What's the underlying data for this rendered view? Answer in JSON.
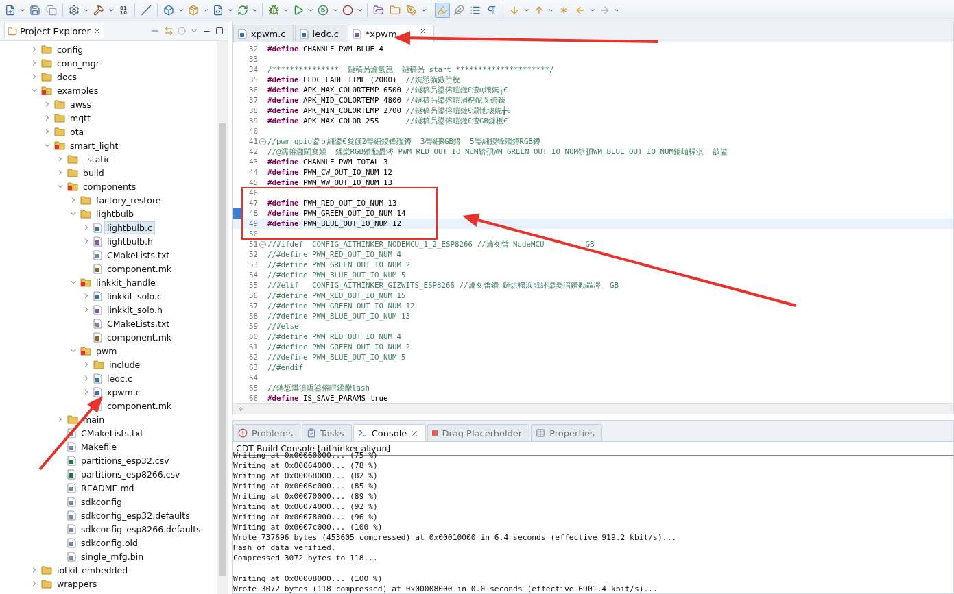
{
  "explorer": {
    "title": "Project Explorer",
    "tree": [
      {
        "label": "config",
        "kind": "folder",
        "expanded": false,
        "selected": false
      },
      {
        "label": "conn_mgr",
        "kind": "folder",
        "expanded": false,
        "selected": false
      },
      {
        "label": "docs",
        "kind": "folder",
        "expanded": false,
        "selected": false
      },
      {
        "label": "examples",
        "kind": "project",
        "expanded": true,
        "selected": false,
        "children": [
          {
            "label": "awss",
            "kind": "folder",
            "expanded": false,
            "selected": false
          },
          {
            "label": "mqtt",
            "kind": "folder",
            "expanded": false,
            "selected": false
          },
          {
            "label": "ota",
            "kind": "folder",
            "expanded": false,
            "selected": false
          },
          {
            "label": "smart_light",
            "kind": "project",
            "expanded": true,
            "selected": false,
            "children": [
              {
                "label": "_static",
                "kind": "folder",
                "expanded": false,
                "selected": false
              },
              {
                "label": "build",
                "kind": "folder",
                "expanded": false,
                "selected": false
              },
              {
                "label": "components",
                "kind": "project",
                "expanded": true,
                "selected": false,
                "children": [
                  {
                    "label": "factory_restore",
                    "kind": "folder",
                    "expanded": false,
                    "selected": false
                  },
                  {
                    "label": "lightbulb",
                    "kind": "folder",
                    "expanded": true,
                    "selected": false,
                    "children": [
                      {
                        "label": "lightbulb.c",
                        "kind": "source",
                        "expanded": false,
                        "selected": true
                      },
                      {
                        "label": "lightbulb.h",
                        "kind": "header",
                        "expanded": false,
                        "selected": false
                      },
                      {
                        "label": "CMakeLists.txt",
                        "kind": "text",
                        "selected": false
                      },
                      {
                        "label": "component.mk",
                        "kind": "make",
                        "selected": false
                      }
                    ]
                  },
                  {
                    "label": "linkkit_handle",
                    "kind": "project",
                    "expanded": true,
                    "selected": false,
                    "children": [
                      {
                        "label": "linkkit_solo.c",
                        "kind": "source",
                        "expanded": false,
                        "selected": false
                      },
                      {
                        "label": "linkkit_solo.h",
                        "kind": "header",
                        "expanded": false,
                        "selected": false
                      },
                      {
                        "label": "CMakeLists.txt",
                        "kind": "text",
                        "selected": false
                      },
                      {
                        "label": "component.mk",
                        "kind": "make",
                        "selected": false
                      }
                    ]
                  },
                  {
                    "label": "pwm",
                    "kind": "project",
                    "expanded": true,
                    "selected": false,
                    "children": [
                      {
                        "label": "include",
                        "kind": "folder",
                        "expanded": false,
                        "selected": false
                      },
                      {
                        "label": "ledc.c",
                        "kind": "source",
                        "expanded": false,
                        "selected": false
                      },
                      {
                        "label": "xpwm.c",
                        "kind": "source",
                        "expanded": false,
                        "selected": false
                      },
                      {
                        "label": "component.mk",
                        "kind": "make",
                        "selected": false
                      }
                    ]
                  }
                ]
              },
              {
                "label": "main",
                "kind": "folder",
                "expanded": false,
                "selected": false
              },
              {
                "label": "CMakeLists.txt",
                "kind": "text",
                "selected": false
              },
              {
                "label": "Makefile",
                "kind": "text",
                "selected": false
              },
              {
                "label": "partitions_esp32.csv",
                "kind": "sheet",
                "selected": false
              },
              {
                "label": "partitions_esp8266.csv",
                "kind": "sheet",
                "selected": false
              },
              {
                "label": "README.md",
                "kind": "text",
                "selected": false
              },
              {
                "label": "sdkconfig",
                "kind": "text",
                "selected": false
              },
              {
                "label": "sdkconfig_esp32.defaults",
                "kind": "text",
                "selected": false
              },
              {
                "label": "sdkconfig_esp8266.defaults",
                "kind": "text",
                "selected": false
              },
              {
                "label": "sdkconfig.old",
                "kind": "text",
                "selected": false
              },
              {
                "label": "single_mfg.bin",
                "kind": "text",
                "selected": false
              }
            ]
          }
        ]
      },
      {
        "label": "iotkit-embedded",
        "kind": "folder",
        "expanded": false,
        "selected": false
      },
      {
        "label": "wrappers",
        "kind": "folder",
        "expanded": false,
        "selected": false
      }
    ]
  },
  "editor_tabs": [
    {
      "label": "xpwm.c",
      "kind": "source",
      "selected": false,
      "closable": false
    },
    {
      "label": "ledc.c",
      "kind": "source",
      "selected": false,
      "closable": false
    },
    {
      "label": "*xpwm",
      "kind": "header",
      "selected": true,
      "closable": true
    }
  ],
  "code": [
    {
      "n": "32",
      "parts": [
        {
          "kind": "keyword",
          "text": "#define"
        },
        {
          "kind": "plain",
          "text": " CHANNLE_PWM_BLUE 4"
        }
      ]
    },
    {
      "n": "33"
    },
    {
      "n": "34",
      "parts": [
        {
          "kind": "comment",
          "text": "/***************  鐩稿叧瀹氫箟  鐩稿叧 start *********************/"
        }
      ]
    },
    {
      "n": "35",
      "parts": [
        {
          "kind": "keyword",
          "text": "#define"
        },
        {
          "kind": "plain",
          "text": " LEDC_FADE_TIME (2000)  "
        },
        {
          "kind": "comment",
          "text": "//娓愬彉鏃堕棿"
        }
      ]
    },
    {
      "n": "36",
      "parts": [
        {
          "kind": "keyword",
          "text": "#define"
        },
        {
          "kind": "plain",
          "text": " APK_MAX_COLORTEMP 6500 "
        },
        {
          "kind": "comment",
          "text": "//鐩稿叧鍙傛暟鏈€澶ц壊娓╁€"
        }
      ]
    },
    {
      "n": "37",
      "parts": [
        {
          "kind": "keyword",
          "text": "#define"
        },
        {
          "kind": "plain",
          "text": " APK_MID_COLORTEMP 4800 "
        },
        {
          "kind": "comment",
          "text": "//鐩稿叧鍙傛暟涓棿鑹叉俯鍊"
        }
      ]
    },
    {
      "n": "38",
      "parts": [
        {
          "kind": "keyword",
          "text": "#define"
        },
        {
          "kind": "plain",
          "text": " APK_MIN_COLORTEMP 2700 "
        },
        {
          "kind": "comment",
          "text": "//鐩稿叧鍙傛暟鏈€灏忚壊娓╁€"
        }
      ]
    },
    {
      "n": "39",
      "parts": [
        {
          "kind": "keyword",
          "text": "#define"
        },
        {
          "kind": "plain",
          "text": " APK_MAX_COLOR 255      "
        },
        {
          "kind": "comment",
          "text": "//鐩稿叧鍙傛暟鏈€澶GB鏁板€"
        }
      ]
    },
    {
      "n": "40"
    },
    {
      "n": "41",
      "fold": true,
      "parts": [
        {
          "kind": "comment",
          "text": "//pwm gpio鍙ｏ細鍙€夋嫨2璺細鍐锋殩鐏  3璺細RGB鐏  5璺細鍐锋殩鐏RGB鐏"
        }
      ]
    },
    {
      "n": "42",
      "parts": [
        {
          "kind": "comment",
          "text": "//@濡傛灉閫夋嫨  鍒欒RGB鐨勫畾涔 PWM_RED_OUT_IO_NUM锛孭WM_GREEN_OUT_IO_NUM锛孭WM_BLUE_OUT_IO_NUM鍚屾椂淇  敼鍙"
        }
      ]
    },
    {
      "n": "43",
      "parts": [
        {
          "kind": "keyword",
          "text": "#define"
        },
        {
          "kind": "plain",
          "text": " CHANNLE_PWM_TOTAL 3"
        }
      ]
    },
    {
      "n": "44",
      "parts": [
        {
          "kind": "keyword",
          "text": "#define"
        },
        {
          "kind": "plain",
          "text": " PWM_CW_OUT_IO_NUM 12"
        }
      ]
    },
    {
      "n": "45",
      "parts": [
        {
          "kind": "keyword",
          "text": "#define"
        },
        {
          "kind": "plain",
          "text": " PWM_WW_OUT_IO_NUM 13"
        }
      ]
    },
    {
      "n": "46",
      "boxed": true
    },
    {
      "n": "47",
      "boxed": true,
      "parts": [
        {
          "kind": "keyword",
          "text": "#define"
        },
        {
          "kind": "plain",
          "text": " PWM_RED_OUT_IO_NUM 13"
        }
      ]
    },
    {
      "n": "48",
      "boxed": true,
      "changed": true,
      "parts": [
        {
          "kind": "keyword",
          "text": "#define"
        },
        {
          "kind": "plain",
          "text": " PWM_GREEN_OUT_IO_NUM 14"
        }
      ]
    },
    {
      "n": "49",
      "boxed": true,
      "current": true,
      "parts": [
        {
          "kind": "keyword",
          "text": "#define"
        },
        {
          "kind": "plain",
          "text": " PWM_BLUE_OUT_IO_NUM 12"
        }
      ]
    },
    {
      "n": "50",
      "boxed": true
    },
    {
      "n": "51",
      "fold": true,
      "parts": [
        {
          "kind": "comment",
          "text": "//#ifdef  CONFIG_AITHINKER_NODEMCU_1_2_ESP8266 //瀹夊畨 NodeMCU"
        },
        {
          "kind": "comment_after_gap",
          "text": "GB"
        }
      ]
    },
    {
      "n": "52",
      "parts": [
        {
          "kind": "comment",
          "text": "//#define PWM_RED_OUT_IO_NUM 4"
        }
      ]
    },
    {
      "n": "53",
      "parts": [
        {
          "kind": "comment",
          "text": "//#define PWM_GREEN_OUT_IO_NUM 2"
        }
      ]
    },
    {
      "n": "54",
      "parts": [
        {
          "kind": "comment",
          "text": "//#define PWM_BLUE_OUT_IO_NUM 5"
        }
      ]
    },
    {
      "n": "55",
      "parts": [
        {
          "kind": "comment",
          "text": "//#elif   CONFIG_AITHINKER_GIZWITS_ESP8266 //瀹夊畨鐨-鏈烘櫤浜戝紑鍙戞澘鐨勫畾涔  GB"
        }
      ]
    },
    {
      "n": "56",
      "parts": [
        {
          "kind": "comment",
          "text": "//#define PWM_RED_OUT_IO_NUM 15"
        }
      ]
    },
    {
      "n": "57",
      "parts": [
        {
          "kind": "comment",
          "text": "//#define PWM_GREEN_OUT_IO_NUM 12"
        }
      ]
    },
    {
      "n": "58",
      "parts": [
        {
          "kind": "comment",
          "text": "//#define PWM_BLUE_OUT_IO_NUM 13"
        }
      ]
    },
    {
      "n": "59",
      "parts": [
        {
          "kind": "comment",
          "text": "//#else"
        }
      ]
    },
    {
      "n": "60",
      "parts": [
        {
          "kind": "comment",
          "text": "//#define PWM_RED_OUT_IO_NUM 4"
        }
      ]
    },
    {
      "n": "61",
      "parts": [
        {
          "kind": "comment",
          "text": "//#define PWM_GREEN_OUT_IO_NUM 2"
        }
      ]
    },
    {
      "n": "62",
      "parts": [
        {
          "kind": "comment",
          "text": "//#define PWM_BLUE_OUT_IO_NUM 5"
        }
      ]
    },
    {
      "n": "63",
      "parts": [
        {
          "kind": "comment",
          "text": "//#endif"
        }
      ]
    },
    {
      "n": "64"
    },
    {
      "n": "65",
      "parts": [
        {
          "kind": "comment",
          "text": "//鏄惁淇濆瓨鍙傛暟鍒癴lash"
        }
      ]
    },
    {
      "n": "66",
      "parts": [
        {
          "kind": "keyword",
          "text": "#define"
        },
        {
          "kind": "plain",
          "text": " IS_SAVE_PARAMS true"
        }
      ]
    }
  ],
  "bottom_tabs": [
    {
      "label": "Problems",
      "kind": "problems",
      "selected": false,
      "closable": false
    },
    {
      "label": "Tasks",
      "kind": "tasks",
      "selected": false,
      "closable": false
    },
    {
      "label": "Console",
      "kind": "console",
      "selected": true,
      "closable": true
    },
    {
      "label": "Drag Placerholder",
      "kind": "placeholder",
      "selected": false,
      "closable": false
    },
    {
      "label": "Properties",
      "kind": "properties",
      "selected": false,
      "closable": false
    }
  ],
  "console": {
    "title": "CDT Build Console [aithinker-aliyun]",
    "lines": [
      {
        "kind": "text",
        "text": "Writing at 0x00060000... (75 %)"
      },
      {
        "kind": "text",
        "text": "Writing at 0x00064000... (78 %)"
      },
      {
        "kind": "text",
        "text": "Writing at 0x00068000... (82 %)"
      },
      {
        "kind": "text",
        "text": "Writing at 0x0006c000... (85 %)"
      },
      {
        "kind": "text",
        "text": "Writing at 0x00070000... (89 %)"
      },
      {
        "kind": "text",
        "text": "Writing at 0x00074000... (92 %)"
      },
      {
        "kind": "text",
        "text": "Writing at 0x00078000... (96 %)"
      },
      {
        "kind": "text",
        "text": "Writing at 0x0007c000... (100 %)"
      },
      {
        "kind": "text",
        "text": "Wrote 737696 bytes (453605 compressed) at 0x00010000 in 6.4 seconds (effective 919.2 kbit/s)..."
      },
      {
        "kind": "text",
        "text": "Hash of data verified."
      },
      {
        "kind": "text",
        "text": "Compressed 3072 bytes to 118..."
      },
      {
        "kind": "gap"
      },
      {
        "kind": "text",
        "text": "Writing at 0x00008000... (100 %)"
      },
      {
        "kind": "text",
        "text": "Wrote 3072 bytes (118 compressed) at 0x00008000 in 0.0 seconds (effective 6901.4 kbit/s)..."
      }
    ]
  }
}
